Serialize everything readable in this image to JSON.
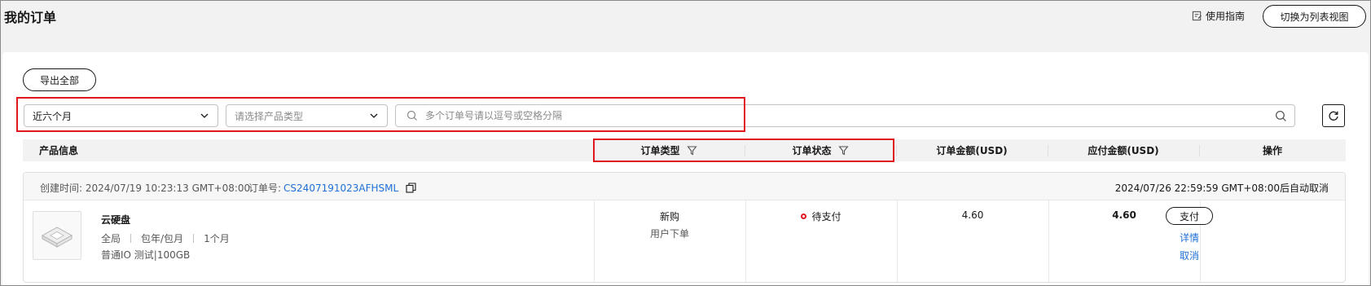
{
  "header": {
    "title": "我的订单",
    "guide_label": "使用指南",
    "switch_view_label": "切换为列表视图"
  },
  "toolbar": {
    "export_label": "导出全部"
  },
  "filters": {
    "period_value": "近六个月",
    "product_type_placeholder": "请选择产品类型",
    "search_placeholder": "多个订单号请以逗号或空格分隔"
  },
  "table": {
    "headers": {
      "product_info": "产品信息",
      "order_type": "订单类型",
      "order_status": "订单状态",
      "order_amount": "订单金额(USD)",
      "payable_amount": "应付金额(USD)",
      "actions": "操作"
    }
  },
  "order": {
    "created_label": "创建时间:",
    "created_time": "2024/07/19 10:23:13 GMT+08:00",
    "order_no_label": "订单号:",
    "order_no": "CS2407191023AFHSML",
    "auto_cancel": "2024/07/26 22:59:59 GMT+08:00后自动取消",
    "product": {
      "name": "云硬盘",
      "region": "全局",
      "billing": "包年/包月",
      "duration": "1个月",
      "spec": "普通IO 测试|100GB",
      "icon": "disk-icon"
    },
    "type_main": "新购",
    "type_sub": "用户下单",
    "status": "待支付",
    "status_color": "#e0181d",
    "order_amount": "4.60",
    "payable_amount": "4.60",
    "actions": {
      "pay": "支付",
      "details": "详情",
      "cancel": "取消"
    }
  },
  "colors": {
    "link": "#1f6fd6",
    "highlight": "#e0181d"
  }
}
